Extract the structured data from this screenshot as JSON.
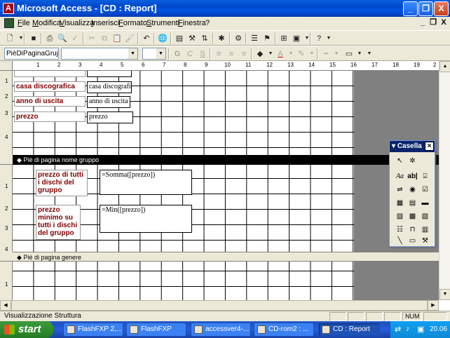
{
  "window": {
    "title": "Microsoft Access - [CD : Report]",
    "app_icon_glyph": "A",
    "minimize_glyph": "_",
    "restore_glyph": "❐",
    "close_glyph": "X"
  },
  "menubar": {
    "items": [
      "File",
      "Modifica",
      "Visualizza",
      "Inserisci",
      "Formato",
      "Strumenti",
      "Finestra",
      "?"
    ],
    "mdi_minimize": "_",
    "mdi_restore": "❐",
    "mdi_close": "X"
  },
  "toolbar2": {
    "object_combo": "PièDiPaginaGruj",
    "font_combo": "",
    "size_combo": ""
  },
  "ruler": {
    "horizontal": [
      "1",
      "2",
      "3",
      "4",
      "5",
      "6",
      "7",
      "8",
      "9",
      "10",
      "11",
      "12",
      "13",
      "14",
      "15",
      "16",
      "17",
      "18",
      "19",
      "2"
    ],
    "vertical_top": [
      "1",
      "2",
      "3",
      "4"
    ],
    "vertical_mid": [
      "1",
      "2",
      "3",
      "4"
    ],
    "vertical_bottom": [
      "1"
    ]
  },
  "report": {
    "detail": [
      {
        "label": "casa discografica",
        "field": "casa discografica"
      },
      {
        "label": "anno di uscita",
        "field": "anno di uscita"
      },
      {
        "label": "prezzo",
        "field": "prezzo"
      }
    ],
    "group_footer": {
      "title": "Piè di pagina nome gruppo",
      "rows": [
        {
          "label": "prezzo di tutti i dischi del gruppo",
          "expr": "=Somma([prezzo])"
        },
        {
          "label": "prezzo minimo su tutti i dischi del gruppo",
          "expr": "=Min([prezzo])"
        }
      ]
    },
    "genre_footer": {
      "title": "Piè di pagina genere"
    }
  },
  "toolbox": {
    "title": "Casella",
    "close_glyph": "×"
  },
  "statusbar": {
    "text": "Visualizzazione Struttura",
    "num": "NUM"
  },
  "taskbar": {
    "start_label": "start",
    "tasks": [
      "FlashFXP 2,...",
      "FlashFXP",
      "accessver4-...",
      "CD-rom2 : ...",
      "CD : Report"
    ],
    "clock": "20.06"
  }
}
